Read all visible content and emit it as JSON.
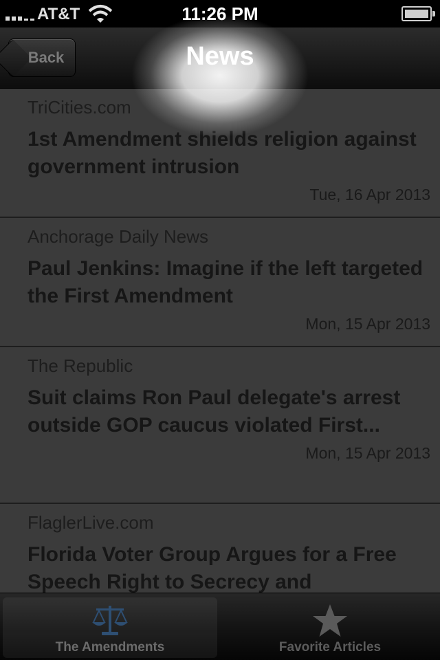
{
  "status_bar": {
    "carrier": "AT&T",
    "time": "11:26 PM"
  },
  "nav": {
    "back_label": "Back",
    "title": "News"
  },
  "news": [
    {
      "source": "TriCities.com",
      "headline": "1st Amendment shields religion against government intrusion",
      "date": "Tue, 16 Apr 2013"
    },
    {
      "source": "Anchorage Daily News",
      "headline": "Paul Jenkins: Imagine if the left targeted the First Amendment",
      "date": "Mon, 15 Apr 2013"
    },
    {
      "source": "The Republic",
      "headline": "Suit claims Ron Paul delegate's arrest outside GOP caucus violated First...",
      "date": "Mon, 15 Apr 2013"
    },
    {
      "source": "FlaglerLive.com",
      "headline": "Florida Voter Group Argues for a Free Speech Right to Secrecy and",
      "date": ""
    }
  ],
  "tabs": [
    {
      "label": "The Amendments",
      "icon": "scales-icon",
      "selected": true
    },
    {
      "label": "Favorite Articles",
      "icon": "star-icon",
      "selected": false
    }
  ],
  "colors": {
    "background": "#3b3b3b",
    "tab_active_icon": "#2e4f73"
  }
}
